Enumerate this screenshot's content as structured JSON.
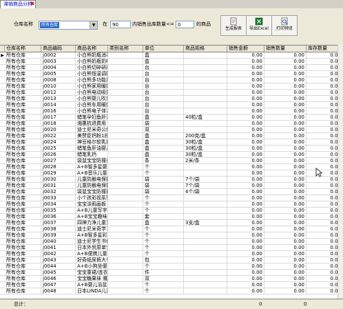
{
  "tab": {
    "title": "滞销商品分析",
    "close": "✖"
  },
  "filter": {
    "warehouse_label": "仓库名称",
    "warehouse_value": "所有仓库",
    "in_label": "在",
    "days_value": "90",
    "qty_label": "内销售出库数量<=",
    "qty_value": "0",
    "suffix_label": "的商品"
  },
  "toolbar": {
    "report_label": "生成报表",
    "excel_label": "导出Excel",
    "print_label": "打印预览"
  },
  "columns": [
    "仓库名称",
    "商品编码",
    "商品名称",
    "类别名称",
    "单位",
    "商品规格",
    "销售金额",
    "销售数量",
    "库存数量"
  ],
  "rows": [
    [
      "所有仓库",
      "j0002",
      "小白熊奶瓶消毒",
      "",
      "盒",
      "",
      "0.00",
      "0.00",
      "0.00"
    ],
    [
      "所有仓库",
      "j0003",
      "小白熊奶瓶奶嘴",
      "",
      "盒",
      "",
      "0.00",
      "0.00",
      "0.00"
    ],
    [
      "所有仓库",
      "j0004",
      "小白熊切碎研磨",
      "",
      "台",
      "",
      "0.00",
      "0.00",
      "0.00"
    ],
    [
      "所有仓库",
      "j0005",
      "小白熊恒温调奶",
      "",
      "台",
      "",
      "0.00",
      "0.00",
      "0.00"
    ],
    [
      "所有仓库",
      "j0008",
      "小白熊多功能果",
      "",
      "台",
      "",
      "0.00",
      "0.00",
      "0.00"
    ],
    [
      "所有仓库",
      "j0010",
      "小白熊家用暖奶",
      "",
      "台",
      "",
      "0.00",
      "0.00",
      "0.00"
    ],
    [
      "所有仓库",
      "j0012",
      "小白熊电动吸奶",
      "",
      "台",
      "",
      "0.00",
      "0.00",
      "0.00"
    ],
    [
      "所有仓库",
      "j0013",
      "小白熊婴儿吹风",
      "",
      "台",
      "",
      "0.00",
      "0.00",
      "0.00"
    ],
    [
      "所有仓库",
      "j0014",
      "小白熊车用暖奶",
      "",
      "台",
      "",
      "0.00",
      "0.00",
      "0.00"
    ],
    [
      "所有仓库",
      "j0016",
      "小白熊电子体温",
      "",
      "台",
      "",
      "0.00",
      "0.00",
      "0.00"
    ],
    [
      "所有仓库",
      "j0017",
      "蜡笔孕妇鱼肝油",
      "",
      "盒",
      "40粒/盒",
      "0.00",
      "0.00",
      "0.00"
    ],
    [
      "所有仓库",
      "j0018",
      "湘惠抗退费用",
      "",
      "袋",
      "",
      "0.00",
      "0.00",
      "0.00"
    ],
    [
      "所有仓库",
      "j0020",
      "迪士尼米奇公仔",
      "",
      "双",
      "",
      "0.00",
      "0.00",
      "0.00"
    ],
    [
      "所有仓库",
      "j0022",
      "美赞臣钙粉1段",
      "",
      "盒",
      "200克/盒",
      "0.00",
      "0.00",
      "0.00"
    ],
    [
      "所有仓库",
      "j0024",
      "神豆格尔软乳钙",
      "",
      "盒",
      "30粒/盒",
      "0.00",
      "0.00",
      "0.00"
    ],
    [
      "所有仓库",
      "j0025",
      "蜡笔鱼肝油婴儿",
      "",
      "盒",
      "30粒/盒",
      "0.00",
      "0.00",
      "0.00"
    ],
    [
      "所有仓库",
      "j0026",
      "蜡笔乳钙",
      "",
      "盒",
      "30粒/盒",
      "0.00",
      "0.00",
      "0.00"
    ],
    [
      "所有仓库",
      "j0027",
      "袋鼠宝宝防撞条",
      "",
      "条",
      "2米/条",
      "0.00",
      "0.00",
      "0.00"
    ],
    [
      "所有仓库",
      "j0028",
      "A+B智多星婴儿",
      "",
      "个",
      "",
      "0.00",
      "0.00",
      "0.00"
    ],
    [
      "所有仓库",
      "j0029",
      "A+B音乐儿童软",
      "",
      "个",
      "",
      "0.00",
      "0.00",
      "0.00"
    ],
    [
      "所有仓库",
      "j0030",
      "儿童防触电保护",
      "",
      "袋",
      "7个/袋",
      "0.00",
      "0.00",
      "0.00"
    ],
    [
      "所有仓库",
      "j0031",
      "儿童防触电保护",
      "",
      "袋",
      "7个/袋",
      "0.00",
      "0.00",
      "0.00"
    ],
    [
      "所有仓库",
      "j0032",
      "袋鼠宝宝防撞护",
      "",
      "袋",
      "4个/袋",
      "0.00",
      "0.00",
      "0.00"
    ],
    [
      "所有仓库",
      "j0033",
      "小个孩彩视系列",
      "",
      "个",
      "",
      "0.00",
      "0.00",
      "0.00"
    ],
    [
      "所有仓库",
      "j0034",
      "宝宝涂鸦画板",
      "",
      "个",
      "",
      "0.00",
      "0.00",
      "0.00"
    ],
    [
      "所有仓库",
      "j0035",
      "A+B儿童写字板",
      "",
      "个",
      "",
      "0.00",
      "0.00",
      "0.00"
    ],
    [
      "所有仓库",
      "j0036",
      "A+B宝宝趣味多",
      "",
      "套",
      "",
      "0.00",
      "0.00",
      "0.00"
    ],
    [
      "所有仓库",
      "j0037",
      "四神力净儿童牙",
      "",
      "盒",
      "3支/盒",
      "0.00",
      "0.00",
      "0.00"
    ],
    [
      "所有仓库",
      "j0038",
      "迪士尼米奇学习",
      "",
      "个",
      "",
      "0.00",
      "0.00",
      "0.00"
    ],
    [
      "所有仓库",
      "j0039",
      "A+B智多星彩视",
      "",
      "个",
      "",
      "0.00",
      "0.00",
      "0.00"
    ],
    [
      "所有仓库",
      "j0040",
      "迪士尼学生书包",
      "",
      "个",
      "",
      "0.00",
      "0.00",
      "0.00"
    ],
    [
      "所有仓库",
      "j0041",
      "日本外贸原单宝",
      "",
      "个",
      "",
      "0.00",
      "0.00",
      "0.00"
    ],
    [
      "所有仓库",
      "j0042",
      "A+B便携儿童餐",
      "",
      "个",
      "",
      "0.00",
      "0.00",
      "0.00"
    ],
    [
      "所有仓库",
      "j0043",
      "好奇纸尿裤大号",
      "",
      "包",
      "",
      "0.00",
      "0.00",
      "0.00"
    ],
    [
      "所有仓库",
      "j0044",
      "A+B小狗坐便器",
      "",
      "个",
      "",
      "0.00",
      "0.00",
      "0.00"
    ],
    [
      "所有仓库",
      "j0045",
      "宝宝童裙/连衣",
      "",
      "件",
      "",
      "0.00",
      "0.00",
      "0.00"
    ],
    [
      "所有仓库",
      "j0046",
      "宝宝糖果袜 鹰",
      "",
      "双",
      "",
      "0.00",
      "0.00",
      "0.00"
    ],
    [
      "所有仓库",
      "j0047",
      "A+B婴儿浴盆",
      "",
      "个",
      "",
      "0.00",
      "0.00",
      "0.00"
    ],
    [
      "所有仓库",
      "j0048",
      "日本LINDA儿童",
      "",
      "个",
      "",
      "0.00",
      "0.00",
      "0.00"
    ]
  ],
  "footer": {
    "total_label": "总计：",
    "sales_total": "0",
    "qty_total": "0"
  },
  "colors": {
    "tab_text": "#0000c0",
    "selection": "#316ac5"
  }
}
